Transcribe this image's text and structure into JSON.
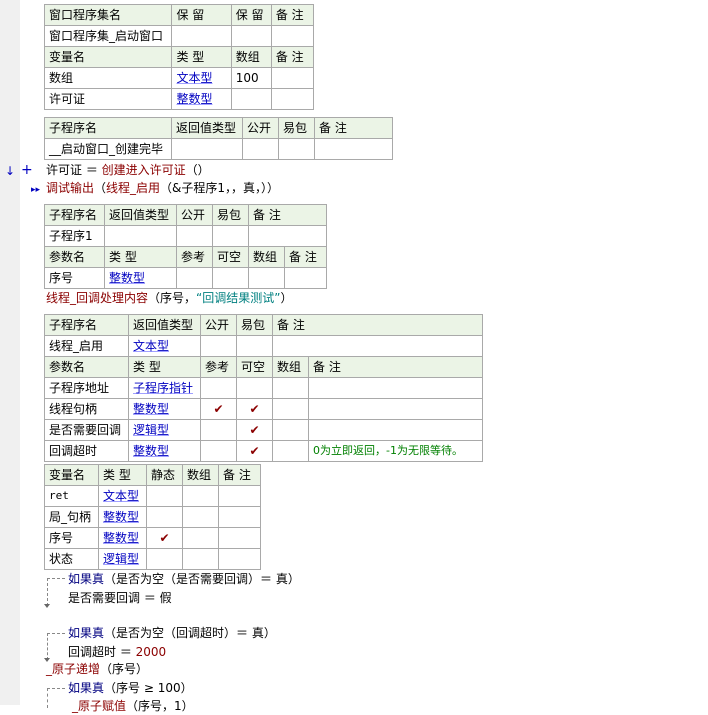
{
  "assembly_table": {
    "headers": [
      "窗口程序集名",
      "保 留",
      "保 留",
      "备 注"
    ],
    "row": [
      "窗口程序集_启动窗口",
      "",
      "",
      ""
    ]
  },
  "var_table_1": {
    "headers": [
      "变量名",
      "类 型",
      "数组",
      "备 注"
    ],
    "rows": [
      [
        "数组",
        "文本型",
        "100",
        ""
      ],
      [
        "许可证",
        "整数型",
        "",
        ""
      ]
    ]
  },
  "sub_table_1": {
    "headers": [
      "子程序名",
      "返回值类型",
      "公开",
      "易包",
      "备 注"
    ],
    "row": [
      "__启动窗口_创建完毕",
      "",
      "",
      "",
      ""
    ]
  },
  "code_lines_1": {
    "line1": "许可证 ＝ 创建进入许可证（）",
    "line1_var": "许可证 ＝ ",
    "line1_fn": "创建进入许可证",
    "line1_rest": "（）",
    "line2_fn": "调试输出",
    "line2_open": "（",
    "line2_fn2": "线程_启用",
    "line2_args": "（&子程序1，，真，））"
  },
  "sub_table_2": {
    "headers": [
      "子程序名",
      "返回值类型",
      "公开",
      "易包",
      "备 注"
    ],
    "row": [
      "子程序1",
      "",
      "",
      "",
      ""
    ],
    "param_headers": [
      "参数名",
      "类 型",
      "参考",
      "可空",
      "数组",
      "备 注"
    ],
    "param_rows": [
      [
        "序号",
        "整数型",
        "",
        "",
        "",
        ""
      ]
    ]
  },
  "code_lines_2": {
    "fn": "线程_回调处理内容",
    "open": "（序号，",
    "str": "“回调结果测试”",
    "close": "）"
  },
  "sub_table_3": {
    "headers": [
      "子程序名",
      "返回值类型",
      "公开",
      "易包",
      "备 注"
    ],
    "row": [
      "线程_启用",
      "文本型",
      "",
      "",
      ""
    ],
    "param_headers": [
      "参数名",
      "类 型",
      "参考",
      "可空",
      "数组",
      "备 注"
    ],
    "param_rows": [
      [
        "子程序地址",
        "子程序指针",
        "",
        "",
        "",
        ""
      ],
      [
        "线程句柄",
        "整数型",
        "✔",
        "✔",
        "",
        ""
      ],
      [
        "是否需要回调",
        "逻辑型",
        "",
        "✔",
        "",
        ""
      ],
      [
        "回调超时",
        "整数型",
        "",
        "✔",
        "",
        "0为立即返回，-1为无限等待。"
      ]
    ]
  },
  "local_var_table": {
    "headers": [
      "变量名",
      "类 型",
      "静态",
      "数组",
      "备 注"
    ],
    "rows": [
      [
        "ret",
        "文本型",
        "",
        "",
        ""
      ],
      [
        "局_句柄",
        "整数型",
        "",
        "",
        ""
      ],
      [
        "序号",
        "整数型",
        "✔",
        "",
        ""
      ],
      [
        "状态",
        "逻辑型",
        "",
        "",
        ""
      ]
    ]
  },
  "code_lines_3": {
    "if1_kw": "如果真",
    "if1_cond": "（是否为空（是否需要回调）＝ 真）",
    "if1_body_var": "是否需要回调 ＝ ",
    "if1_body_val": "假",
    "if2_kw": "如果真",
    "if2_cond": "（是否为空（回调超时）＝ 真）",
    "if2_body_var": "回调超时 ＝ ",
    "if2_body_val": "2000",
    "atomic_fn": "_原子递增",
    "atomic_args": "（序号）",
    "if3_kw": "如果真",
    "if3_cond": "（序号 ≥ 100）",
    "partial_fn": "_原子赋值",
    "partial_args": "（序号，1）"
  },
  "colors": {
    "header_bg": "#ebf4e6",
    "type_blue": "#0000c0",
    "func_red": "#8b0000",
    "string_teal": "#008080",
    "note_green": "#008000",
    "gutter": "#f0f0f0"
  },
  "icons": [
    "down-arrow-icon",
    "plus-icon",
    "breakpoint-arrow-icon",
    "check-icon"
  ]
}
